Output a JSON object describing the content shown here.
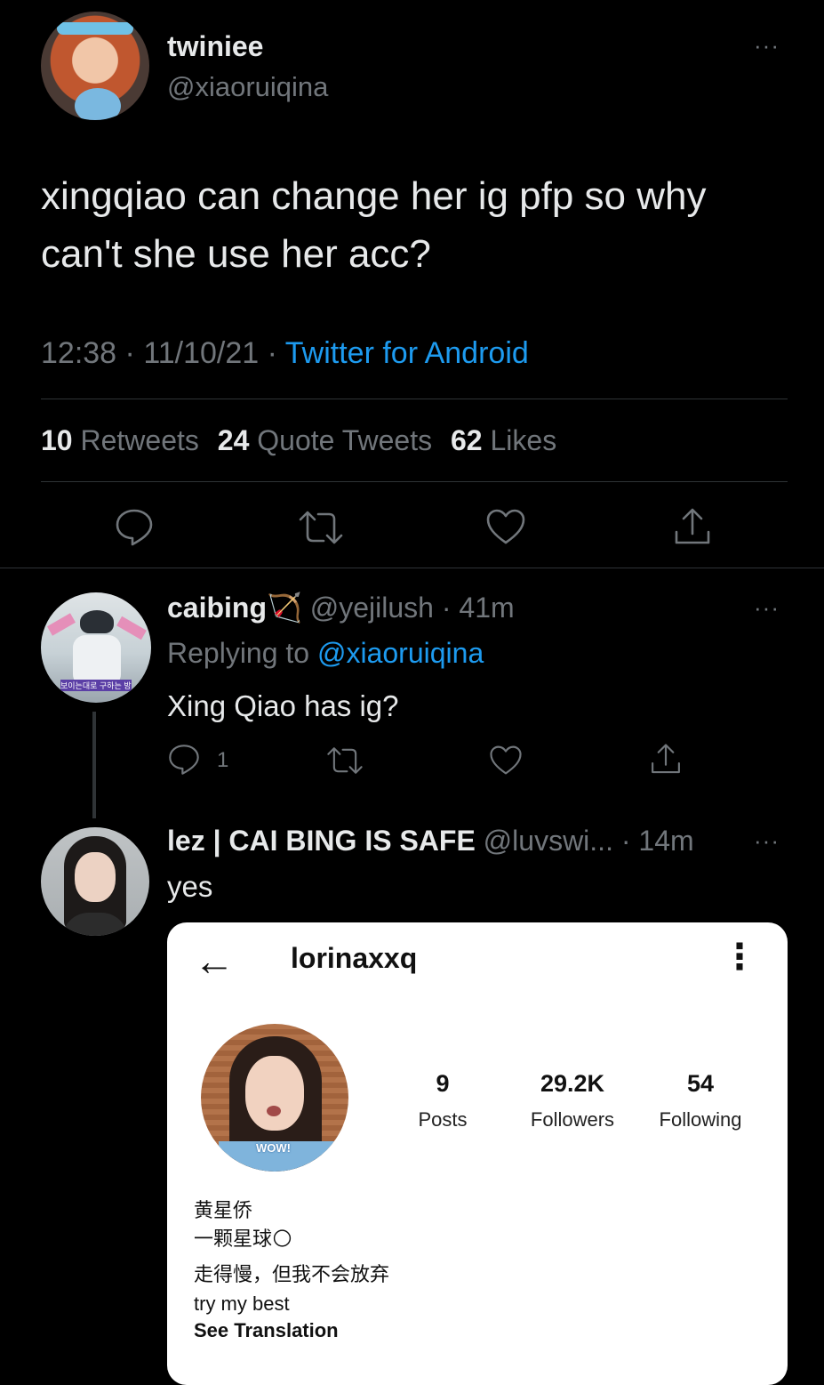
{
  "tweet": {
    "author_name": "twiniee",
    "author_handle": "@xiaoruiqina",
    "text_line1": "xingqiao can change her ig pfp so why",
    "text_line2": "can't she use her acc?",
    "time": "12:38",
    "sep": "·",
    "date": "11/10/21",
    "source": "Twitter for Android",
    "stats": [
      {
        "num": "10",
        "label": "Retweets"
      },
      {
        "num": "24",
        "label": "Quote Tweets"
      },
      {
        "num": "62",
        "label": "Likes"
      }
    ],
    "more_icon": "···"
  },
  "reply1": {
    "author_name": "caibing",
    "emoji": "🏹",
    "author_handle": "@yejilush",
    "time": "· 41m",
    "replying_prefix": "Replying to",
    "replying_handle": "@xiaoruiqina",
    "text": "Xing Qiao has ig?",
    "reply_count": "1",
    "avatar_caption": "보이는대로 구하는 방법"
  },
  "reply2": {
    "author_name": "lez | CAI BING IS SAFE",
    "author_handle": "@luvswi...",
    "time": "· 14m",
    "text": "yes"
  },
  "instagram": {
    "back_icon": "←",
    "username": "lorinaxxq",
    "menu_icon": "⋮",
    "avatar_caption": "WOW!",
    "stats": [
      {
        "num": "9",
        "label": "Posts"
      },
      {
        "num": "29.2K",
        "label": "Followers"
      },
      {
        "num": "54",
        "label": "Following"
      }
    ],
    "bio_line1": "黄星侨",
    "bio_line2": "一颗星球",
    "bio_line2_emoji": "🌕",
    "bio_line3": "走得慢，但我不会放弃",
    "bio_line4": "try my best",
    "see_translation": "See Translation"
  },
  "colors": {
    "background": "#000000",
    "text": "#e7e9ea",
    "muted": "#71767b",
    "link": "#1d9bf0",
    "divider": "#2f3336"
  }
}
